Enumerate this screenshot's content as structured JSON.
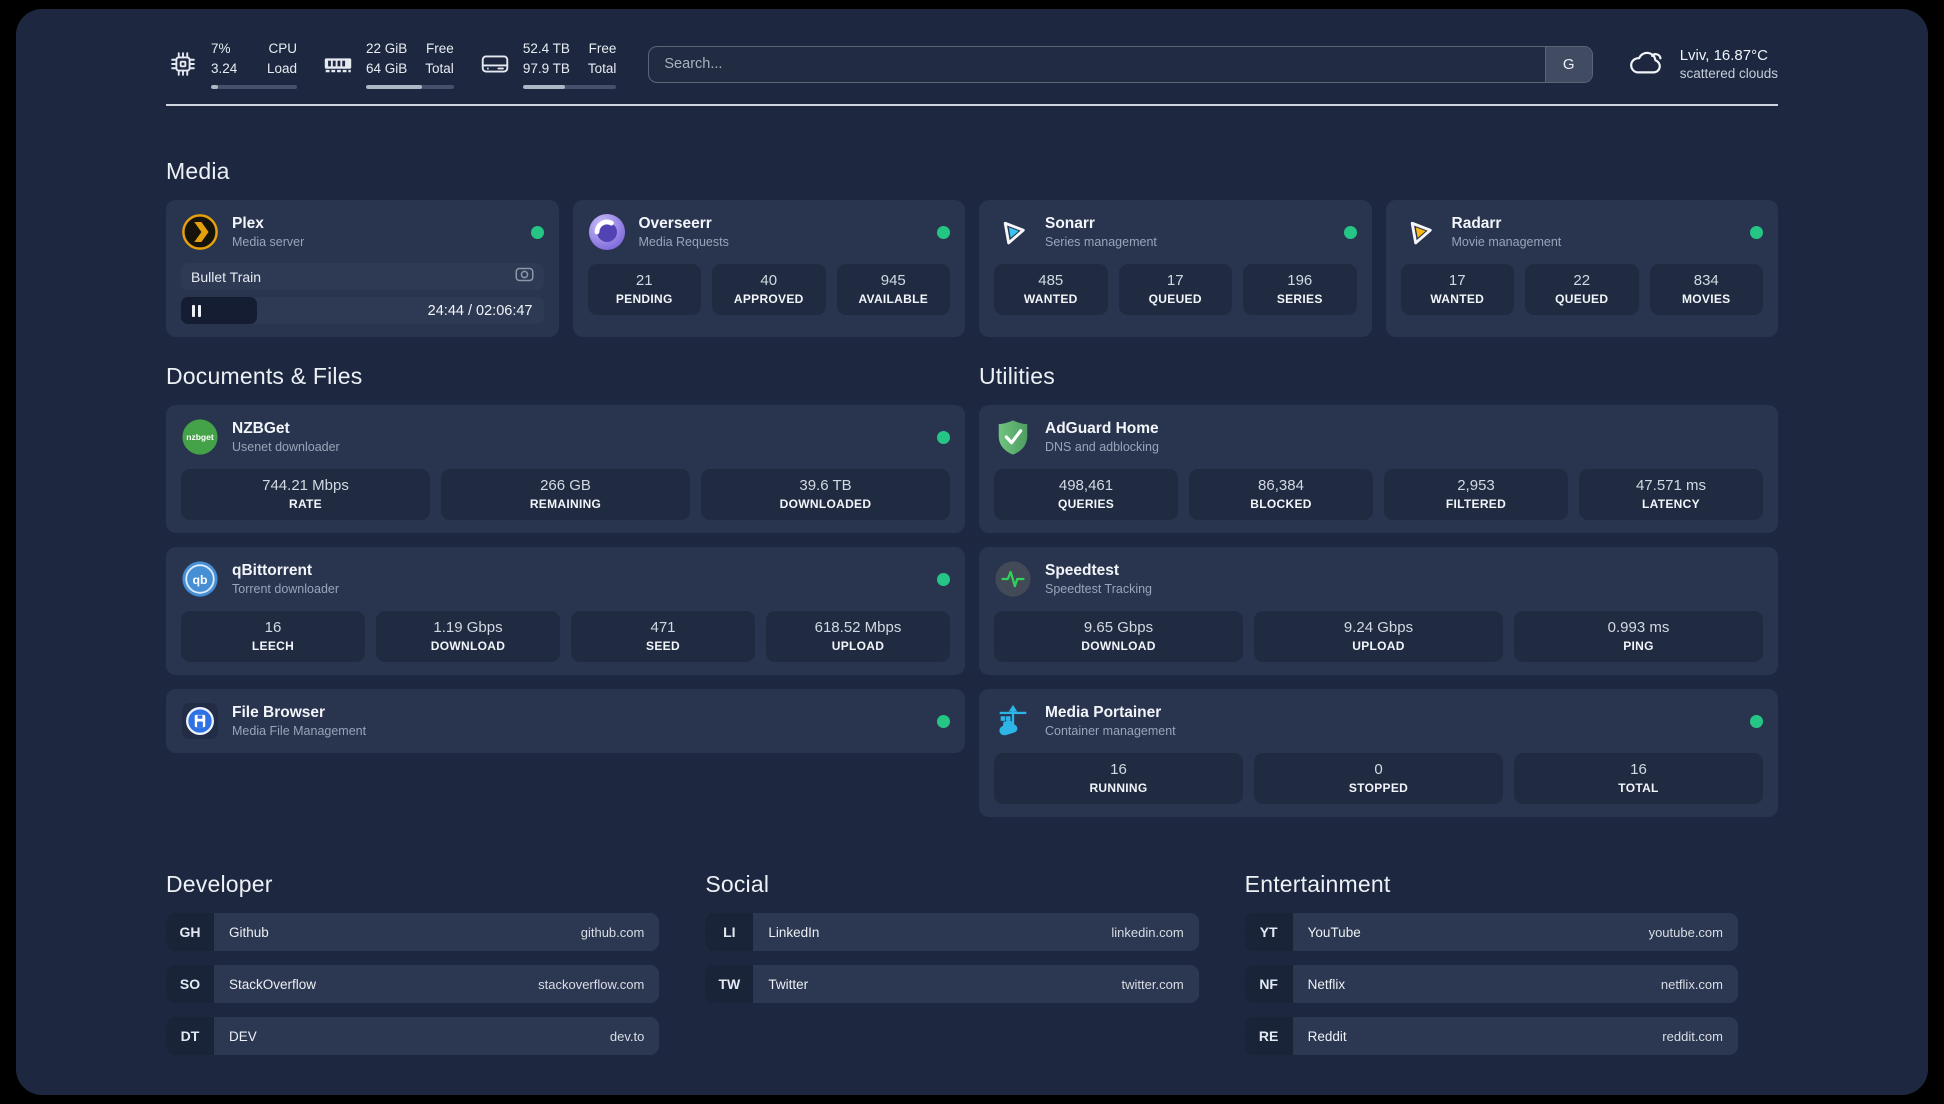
{
  "colors": {
    "background": "#000000",
    "panel": "#1d2840",
    "card": "#29344e",
    "stat_box": "#202b42",
    "online_dot": "#25c685",
    "accent_plex": "#e5a00d",
    "accent_sonarr": "#38c3f1",
    "accent_radarr": "#fdb714",
    "text_primary": "#f2f5f9",
    "text_secondary": "#9aa4b8"
  },
  "topbar": {
    "metrics": [
      {
        "icon": "cpu-icon",
        "line1_value": "7%",
        "line2_value": "3.24",
        "line1_label": "CPU",
        "line2_label": "Load",
        "progress_percent": 8
      },
      {
        "icon": "memory-icon",
        "line1_value": "22 GiB",
        "line2_value": "64 GiB",
        "line1_label": "Free",
        "line2_label": "Total",
        "progress_percent": 64
      },
      {
        "icon": "disk-icon",
        "line1_value": "52.4 TB",
        "line2_value": "97.9 TB",
        "line1_label": "Free",
        "line2_label": "Total",
        "progress_percent": 45
      }
    ],
    "search": {
      "placeholder": "Search...",
      "button_label": "G"
    },
    "weather": {
      "icon": "cloud-icon",
      "location_temp": "Lviv, 16.87°C",
      "condition": "scattered clouds"
    }
  },
  "media": {
    "title": "Media",
    "cards": [
      {
        "icon": "plex-icon",
        "title": "Plex",
        "subtitle": "Media server",
        "status": "online",
        "player": {
          "track": "Bullet Train",
          "time_display": "24:44 / 02:06:47",
          "progress_percent": 21
        }
      },
      {
        "icon": "overseerr-icon",
        "title": "Overseerr",
        "subtitle": "Media Requests",
        "status": "online",
        "stats": [
          {
            "value": "21",
            "label": "PENDING"
          },
          {
            "value": "40",
            "label": "APPROVED"
          },
          {
            "value": "945",
            "label": "AVAILABLE"
          }
        ]
      },
      {
        "icon": "sonarr-icon",
        "title": "Sonarr",
        "subtitle": "Series management",
        "status": "online",
        "stats": [
          {
            "value": "485",
            "label": "WANTED"
          },
          {
            "value": "17",
            "label": "QUEUED"
          },
          {
            "value": "196",
            "label": "SERIES"
          }
        ]
      },
      {
        "icon": "radarr-icon",
        "title": "Radarr",
        "subtitle": "Movie management",
        "status": "online",
        "stats": [
          {
            "value": "17",
            "label": "WANTED"
          },
          {
            "value": "22",
            "label": "QUEUED"
          },
          {
            "value": "834",
            "label": "MOVIES"
          }
        ]
      }
    ]
  },
  "documents": {
    "title": "Documents & Files",
    "cards": [
      {
        "icon": "nzbget-icon",
        "title": "NZBGet",
        "subtitle": "Usenet downloader",
        "status": "online",
        "stats": [
          {
            "value": "744.21 Mbps",
            "label": "RATE"
          },
          {
            "value": "266 GB",
            "label": "REMAINING"
          },
          {
            "value": "39.6 TB",
            "label": "DOWNLOADED"
          }
        ]
      },
      {
        "icon": "qbittorrent-icon",
        "title": "qBittorrent",
        "subtitle": "Torrent downloader",
        "status": "online",
        "stats": [
          {
            "value": "16",
            "label": "LEECH"
          },
          {
            "value": "1.19 Gbps",
            "label": "DOWNLOAD"
          },
          {
            "value": "471",
            "label": "SEED"
          },
          {
            "value": "618.52 Mbps",
            "label": "UPLOAD"
          }
        ]
      },
      {
        "icon": "filebrowser-icon",
        "title": "File Browser",
        "subtitle": "Media File Management",
        "status": "online"
      }
    ]
  },
  "utilities": {
    "title": "Utilities",
    "cards": [
      {
        "icon": "adguard-icon",
        "title": "AdGuard Home",
        "subtitle": "DNS and adblocking",
        "stats": [
          {
            "value": "498,461",
            "label": "QUERIES"
          },
          {
            "value": "86,384",
            "label": "BLOCKED"
          },
          {
            "value": "2,953",
            "label": "FILTERED"
          },
          {
            "value": "47.571 ms",
            "label": "LATENCY"
          }
        ]
      },
      {
        "icon": "speedtest-icon",
        "title": "Speedtest",
        "subtitle": "Speedtest Tracking",
        "stats": [
          {
            "value": "9.65 Gbps",
            "label": "DOWNLOAD"
          },
          {
            "value": "9.24 Gbps",
            "label": "UPLOAD"
          },
          {
            "value": "0.993 ms",
            "label": "PING"
          }
        ]
      },
      {
        "icon": "portainer-icon",
        "title": "Media Portainer",
        "subtitle": "Container management",
        "status": "online",
        "stats": [
          {
            "value": "16",
            "label": "RUNNING"
          },
          {
            "value": "0",
            "label": "STOPPED"
          },
          {
            "value": "16",
            "label": "TOTAL"
          }
        ]
      }
    ]
  },
  "links": [
    {
      "title": "Developer",
      "items": [
        {
          "tag": "GH",
          "name": "Github",
          "url": "github.com"
        },
        {
          "tag": "SO",
          "name": "StackOverflow",
          "url": "stackoverflow.com"
        },
        {
          "tag": "DT",
          "name": "DEV",
          "url": "dev.to"
        }
      ]
    },
    {
      "title": "Social",
      "items": [
        {
          "tag": "LI",
          "name": "LinkedIn",
          "url": "linkedin.com"
        },
        {
          "tag": "TW",
          "name": "Twitter",
          "url": "twitter.com"
        }
      ]
    },
    {
      "title": "Entertainment",
      "items": [
        {
          "tag": "YT",
          "name": "YouTube",
          "url": "youtube.com"
        },
        {
          "tag": "NF",
          "name": "Netflix",
          "url": "netflix.com"
        },
        {
          "tag": "RE",
          "name": "Reddit",
          "url": "reddit.com"
        }
      ]
    }
  ]
}
